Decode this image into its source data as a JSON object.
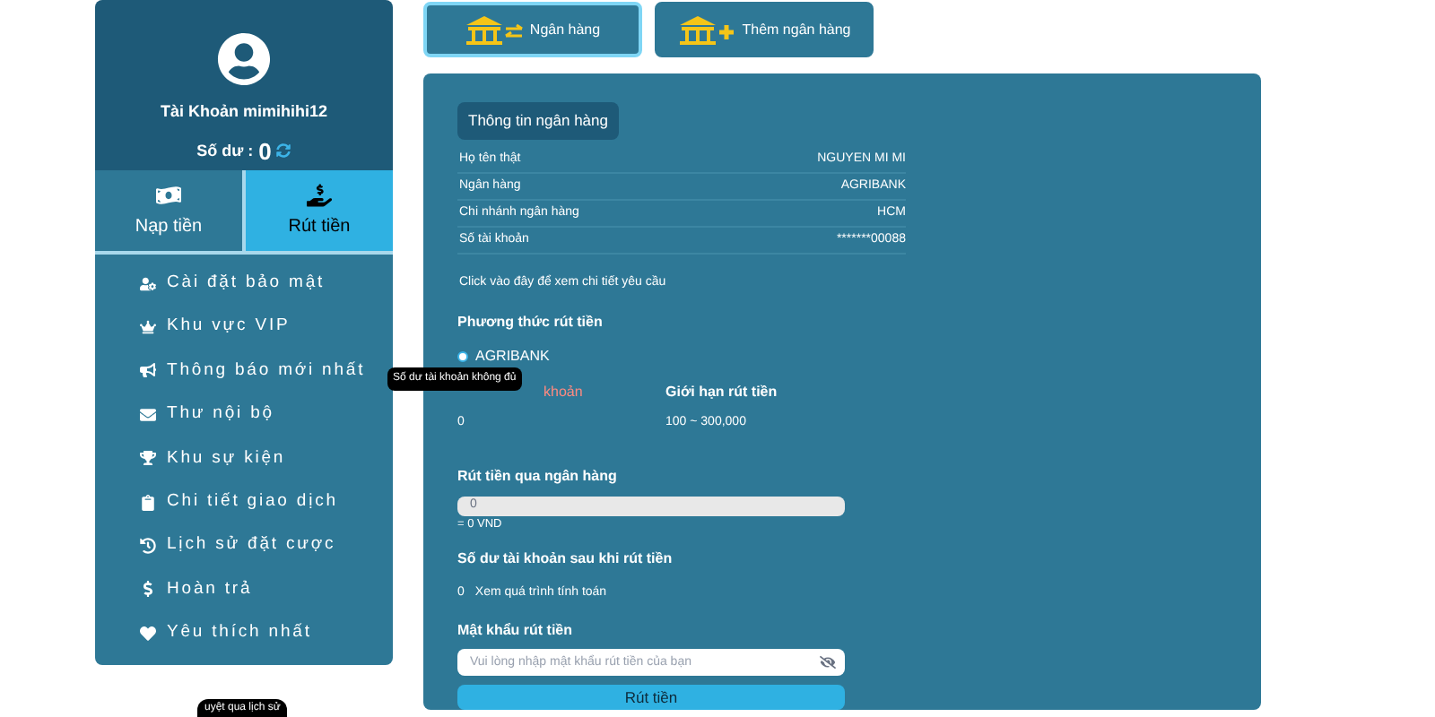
{
  "account": {
    "name": "Tài Khoản mimihihi12",
    "balance_label": "Số dư :",
    "balance": "0"
  },
  "actions": [
    {
      "label": "Nạp tiền",
      "kind": "deposit",
      "selected": false
    },
    {
      "label": "Rút tiền",
      "kind": "withdraw",
      "selected": true
    }
  ],
  "menu": [
    {
      "label": "Cài đặt bảo mật",
      "kind": "security"
    },
    {
      "label": "Khu vực VIP",
      "kind": "vip"
    },
    {
      "label": "Thông báo mới nhất",
      "kind": "news"
    },
    {
      "label": "Thư nội bộ",
      "kind": "mail"
    },
    {
      "label": "Khu sự kiện",
      "kind": "event"
    },
    {
      "label": "Chi tiết giao dịch",
      "kind": "detail"
    },
    {
      "label": "Lịch sử đặt cược",
      "kind": "history"
    },
    {
      "label": "Hoàn trả",
      "kind": "refund"
    },
    {
      "label": "Yêu thích nhất",
      "kind": "favorite"
    }
  ],
  "tabs": [
    {
      "label": "Ngân hàng",
      "kind": "bank",
      "selected": true
    },
    {
      "label": "Thêm ngân hàng",
      "kind": "add",
      "selected": false
    }
  ],
  "bank_info": {
    "title": "Thông tin ngân hàng",
    "rows": [
      {
        "label": "Họ tên thật",
        "value": "NGUYEN MI MI"
      },
      {
        "label": "Ngân hàng",
        "value": "AGRIBANK"
      },
      {
        "label": "Chi nhánh ngân hàng",
        "value": "HCM"
      },
      {
        "label": "Số tài khoản",
        "value": "*******00088"
      }
    ],
    "link": "Click vào đây để xem chi tiết yêu cầu"
  },
  "method": {
    "title": "Phương thức rút tiền",
    "options": [
      {
        "label": "AGRIBANK",
        "selected": true
      }
    ]
  },
  "balance_col": {
    "label": "khoản",
    "value": "0"
  },
  "limit_col": {
    "label": "Giới hạn rút tiền",
    "value": "100 ~ 300,000"
  },
  "tooltip": "Số dư tài khoản không đủ",
  "amount": {
    "title": "Rút tiền qua ngân hàng",
    "value": "0",
    "converted": "= 0 VND"
  },
  "after": {
    "title": "Số dư tài khoản sau khi rút tiền",
    "value": "0",
    "link": "Xem quá trình tính toán"
  },
  "password": {
    "title": "Mật khẩu rút tiền",
    "placeholder": "Vui lòng nhập mật khẩu rút tiền của bạn"
  },
  "submit": "Rút tiền",
  "bottom_tooltip": "uyệt qua lịch sử"
}
